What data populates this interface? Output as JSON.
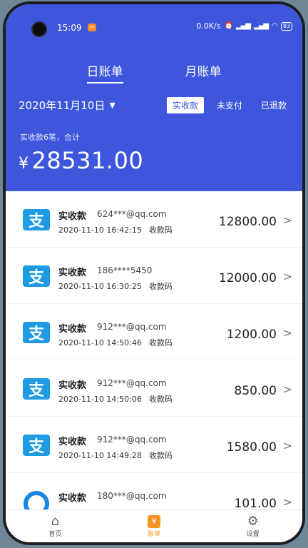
{
  "status": {
    "time": "15:09",
    "network": "0.0K/s",
    "battery": "83"
  },
  "tabs": [
    {
      "label": "日账单",
      "active": true
    },
    {
      "label": "月账单",
      "active": false
    }
  ],
  "date": "2020年11月10日",
  "filters": [
    "实收款",
    "未支付",
    "已退款"
  ],
  "summary": "实收款6笔，合计",
  "total": {
    "currency": "¥",
    "value": "28531.00"
  },
  "transactions": [
    {
      "title": "实收款",
      "account": "624***@qq.com",
      "time": "2020-11-10 16:42:15",
      "method": "收款码",
      "amount": "12800.00",
      "icon": "alipay-icon"
    },
    {
      "title": "实收款",
      "account": "186****5450",
      "time": "2020-11-10 16:30:25",
      "method": "收款码",
      "amount": "12000.00",
      "icon": "alipay-icon"
    },
    {
      "title": "实收款",
      "account": "912***@qq.com",
      "time": "2020-11-10 14:50:46",
      "method": "收款码",
      "amount": "1200.00",
      "icon": "alipay-icon"
    },
    {
      "title": "实收款",
      "account": "912***@qq.com",
      "time": "2020-11-10 14:50:06",
      "method": "收款码",
      "amount": "850.00",
      "icon": "alipay-icon"
    },
    {
      "title": "实收款",
      "account": "912***@qq.com",
      "time": "2020-11-10 14:49:28",
      "method": "收款码",
      "amount": "1580.00",
      "icon": "alipay-icon"
    },
    {
      "title": "实收款",
      "account": "180***@qq.com",
      "time": "",
      "method": "",
      "amount": "101.00",
      "icon": "round-pay-icon"
    }
  ],
  "nav": [
    {
      "label": "首页",
      "icon": "home-icon"
    },
    {
      "label": "账单",
      "icon": "bill-icon",
      "active": true
    },
    {
      "label": "设置",
      "icon": "gear-icon"
    }
  ],
  "colors": {
    "primary": "#3d56db",
    "alipay": "#1f9be3",
    "nav_active": "#f39321"
  }
}
